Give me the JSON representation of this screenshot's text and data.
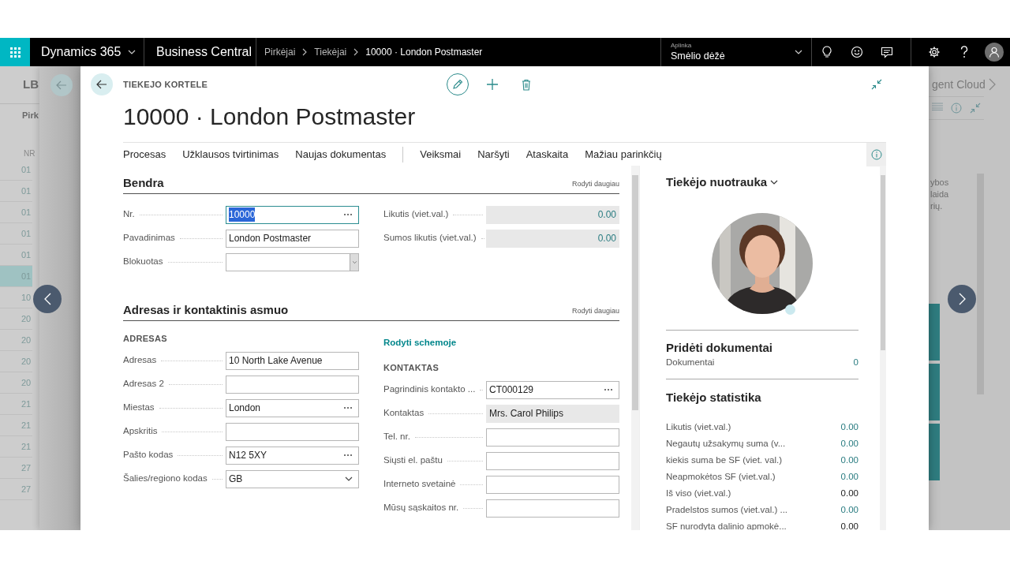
{
  "top_bar": {
    "app_name": "Dynamics 365",
    "product": "Business Central",
    "breadcrumbs": [
      {
        "label": "Pirkėjai",
        "current": false
      },
      {
        "label": "Tiekėjai",
        "current": false
      },
      {
        "label": "10000 · London Postmaster",
        "current": true
      }
    ],
    "environment": {
      "label": "Aplinka",
      "value": "Smėlio dėžė"
    }
  },
  "background_page": {
    "title": "LB",
    "subtitle": "Pirk",
    "column_header": "NR",
    "rows": [
      {
        "text": "01",
        "selected": false
      },
      {
        "text": "01",
        "selected": false
      },
      {
        "text": "01",
        "selected": false
      },
      {
        "text": "01",
        "selected": false
      },
      {
        "text": "01",
        "selected": false
      },
      {
        "text": "01",
        "selected": true
      },
      {
        "text": "10",
        "selected": false
      },
      {
        "text": "20",
        "selected": false
      },
      {
        "text": "20",
        "selected": false
      },
      {
        "text": "20",
        "selected": false
      },
      {
        "text": "20",
        "selected": false
      },
      {
        "text": "21",
        "selected": false
      },
      {
        "text": "21",
        "selected": false
      },
      {
        "text": "21",
        "selected": false
      },
      {
        "text": "27",
        "selected": false
      },
      {
        "text": "27",
        "selected": false
      }
    ],
    "right_title": "gent Cloud",
    "right_lines": [
      "ybos",
      "laida",
      "rių."
    ]
  },
  "card": {
    "caption": "TIEKEJO KORTELE",
    "title": "10000 · London Postmaster",
    "action_groups": [
      [
        "Procesas",
        "Užklausos tvirtinimas",
        "Naujas dokumentas"
      ],
      [
        "Veiksmai",
        "Naršyti",
        "Ataskaita",
        "Mažiau parinkčių"
      ]
    ],
    "sections": [
      {
        "title": "Bendra",
        "show_more": "Rodyti daugiau",
        "left": {
          "fields": [
            {
              "label": "Nr.",
              "value": "10000",
              "kind": "lookup",
              "focused": true
            },
            {
              "label": "Pavadinimas",
              "value": "London Postmaster",
              "kind": "text",
              "focused": false
            },
            {
              "label": "Blokuotas",
              "kind": "select",
              "focused": false
            }
          ]
        },
        "right": {
          "fields": [
            {
              "label": "Likutis (viet.val.)",
              "value": "0.00",
              "kind": "amount"
            },
            {
              "label": "Sumos likutis (viet.val.)",
              "value": "0.00",
              "kind": "amount"
            }
          ]
        }
      },
      {
        "title": "Adresas ir kontaktinis asmuo",
        "show_more": "Rodyti daugiau",
        "left": {
          "caption": "ADRESAS",
          "fields": [
            {
              "label": "Adresas",
              "value": "10 North Lake Avenue",
              "kind": "text"
            },
            {
              "label": "Adresas 2",
              "kind": "text"
            },
            {
              "label": "Miestas",
              "value": "London",
              "kind": "lookup"
            },
            {
              "label": "Apskritis",
              "kind": "text"
            },
            {
              "label": "Pašto kodas",
              "value": "N12 5XY",
              "kind": "lookup"
            },
            {
              "label": "Šalies/regiono kodas",
              "value": "GB",
              "kind": "dropdown"
            }
          ]
        },
        "right": {
          "link": "Rodyti schemoje",
          "caption": "KONTAKTAS",
          "fields": [
            {
              "label": "Pagrindinis kontakto ...",
              "value": "CT000129",
              "kind": "lookup"
            },
            {
              "label": "Kontaktas",
              "value": "Mrs. Carol Philips",
              "kind": "readonly"
            },
            {
              "label": "Tel. nr.",
              "kind": "text"
            },
            {
              "label": "Siųsti el. paštu",
              "kind": "text"
            },
            {
              "label": "Interneto svetainė",
              "kind": "text"
            },
            {
              "label": "Mūsų sąskaitos nr.",
              "kind": "text"
            }
          ]
        }
      }
    ]
  },
  "factbox": {
    "picture_title": "Tiekėjo nuotrauka",
    "attachments": {
      "title": "Pridėti dokumentai",
      "rows": [
        {
          "label": "Dokumentai",
          "value": "0",
          "link": true
        }
      ]
    },
    "statistics": {
      "title": "Tiekėjo statistika",
      "rows": [
        {
          "label": "Likutis (viet.val.)",
          "value": "0.00",
          "link": true
        },
        {
          "label": "Negautų užsakymų suma (v...",
          "value": "0.00",
          "link": true
        },
        {
          "label": "kiekis suma be SF (viet. val.)",
          "value": "0.00",
          "link": true
        },
        {
          "label": "Neapmokėtos SF (viet.val.)",
          "value": "0.00",
          "link": true
        },
        {
          "label": "Iš viso (viet.val.)",
          "value": "0.00",
          "link": false
        },
        {
          "label": "Pradelstos sumos (viet.val.) ...",
          "value": "0.00",
          "link": true
        },
        {
          "label": "SF nurodyta dalinio apmokė...",
          "value": "0.00",
          "link": false
        }
      ]
    }
  }
}
